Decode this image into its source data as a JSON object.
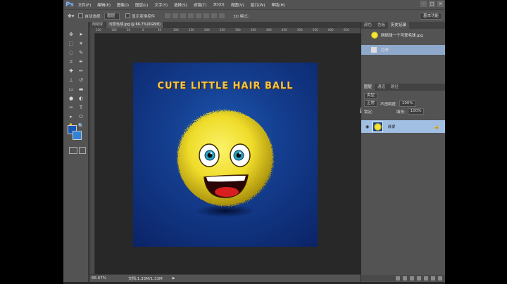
{
  "app": {
    "logo": "Ps"
  },
  "menu": [
    "文件(F)",
    "编辑(E)",
    "图像(I)",
    "图层(L)",
    "文字(Y)",
    "选择(S)",
    "滤镜(T)",
    "3D(D)",
    "视图(V)",
    "窗口(W)",
    "帮助(H)"
  ],
  "options": {
    "auto_select_label": "自动选择:",
    "auto_select_value": "图层",
    "show_transform_label": "显示变换控件",
    "mode_3d": "3D 模式:",
    "workspace": "基本功能"
  },
  "tabs": [
    {
      "label": "网络球"
    },
    {
      "label": "可爱毛球.jpg @ 66.7%(RGB/8)"
    }
  ],
  "ruler": [
    "150",
    "100",
    "50",
    "0",
    "50",
    "100",
    "150",
    "200",
    "250",
    "300",
    "350",
    "400",
    "450",
    "500",
    "550",
    "600",
    "650"
  ],
  "document": {
    "title": "CUTE LITTLE HAIR BALL"
  },
  "status": {
    "zoom": "66.67%",
    "doc_size": "文档:1.33M/1.33M"
  },
  "history": {
    "tabs": [
      "颜色",
      "色板",
      "历史记录"
    ],
    "items": [
      {
        "label": "网络球一个可爱毛球.jpg"
      },
      {
        "label": "打开"
      }
    ]
  },
  "layers": {
    "tabs": [
      "图层",
      "通道",
      "路径"
    ],
    "kind_label": "类型",
    "blend_mode": "正常",
    "opacity_label": "不透明度:",
    "opacity_value": "100%",
    "lock_label": "锁定:",
    "fill_label": "填充:",
    "fill_value": "100%",
    "items": [
      {
        "name": "背景"
      }
    ]
  },
  "colors": {
    "foreground": "#1a56b3",
    "background": "#2e84d9",
    "title_gold": "#f5c64a",
    "ball_yellow": "#f2e236"
  }
}
